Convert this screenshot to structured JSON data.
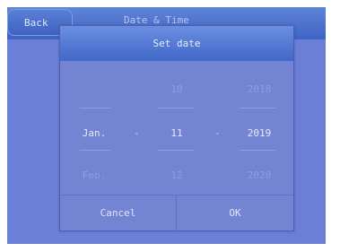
{
  "header": {
    "back_label": "Back",
    "title": "Date & Time"
  },
  "dialog": {
    "title": "Set date",
    "month": {
      "prev": "",
      "current": "Jan.",
      "next": "Feb."
    },
    "day": {
      "prev": "10",
      "current": "11",
      "next": "12"
    },
    "year": {
      "prev": "2018",
      "current": "2019",
      "next": "2020"
    },
    "separator": "-",
    "cancel_label": "Cancel",
    "ok_label": "OK"
  }
}
